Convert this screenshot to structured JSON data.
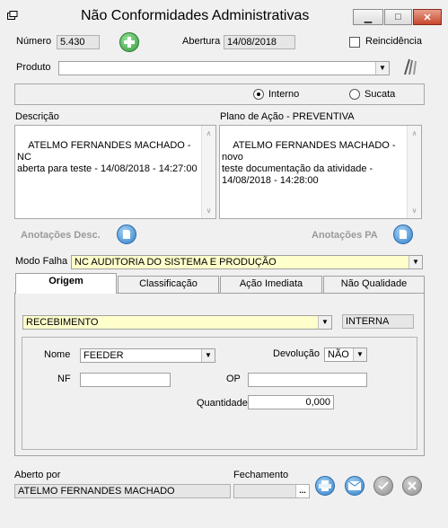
{
  "window": {
    "title": "Não Conformidades Administrativas",
    "min_glyph": "▁",
    "max_glyph": "□",
    "close_glyph": "✕"
  },
  "header": {
    "numero_label": "Número",
    "numero_value": "5.430",
    "abertura_label": "Abertura",
    "abertura_value": "14/08/2018",
    "reincidencia_label": "Reincidência",
    "reincidencia_checked": false
  },
  "produto": {
    "label": "Produto",
    "value": ""
  },
  "origem_tipo": {
    "options": [
      "Interno",
      "Sucata"
    ],
    "selected": "Interno"
  },
  "descricao": {
    "label": "Descrição",
    "text": "ATELMO FERNANDES MACHADO - NC\naberta para teste - 14/08/2018 - 14:27:00"
  },
  "plano_acao": {
    "label": "Plano de Ação - PREVENTIVA",
    "text": "ATELMO FERNANDES MACHADO - novo\nteste documentação da atividade -\n14/08/2018 - 14:28:00"
  },
  "anotacoes": {
    "desc_label": "Anotações Desc.",
    "pa_label": "Anotações PA"
  },
  "modo_falha": {
    "label": "Modo Falha",
    "value": "NC AUDITORIA DO SISTEMA E PRODUÇÃO"
  },
  "tabs": [
    {
      "label": "Origem",
      "active": true
    },
    {
      "label": "Classificação",
      "active": false
    },
    {
      "label": "Ação Imediata",
      "active": false
    },
    {
      "label": "Não Qualidade",
      "active": false
    }
  ],
  "origem": {
    "recebimento_value": "RECEBIMENTO",
    "tipo_value": "INTERNA",
    "nome_label": "Nome",
    "nome_value": "FEEDER",
    "devolucao_label": "Devolução",
    "devolucao_value": "NÃO",
    "nf_label": "NF",
    "nf_value": "",
    "op_label": "OP",
    "op_value": "",
    "quantidade_label": "Quantidade",
    "quantidade_value": "0,000"
  },
  "footer": {
    "aberto_por_label": "Aberto por",
    "aberto_por_value": "ATELMO FERNANDES MACHADO",
    "fechamento_label": "Fechamento",
    "fechamento_value": "",
    "ellipsis": "..."
  },
  "colors": {
    "highlight_yellow": "#ffffcc",
    "add_green": "#3cb54a",
    "blue_button": "#3a8fd8",
    "gray_button": "#9a9a9a"
  }
}
